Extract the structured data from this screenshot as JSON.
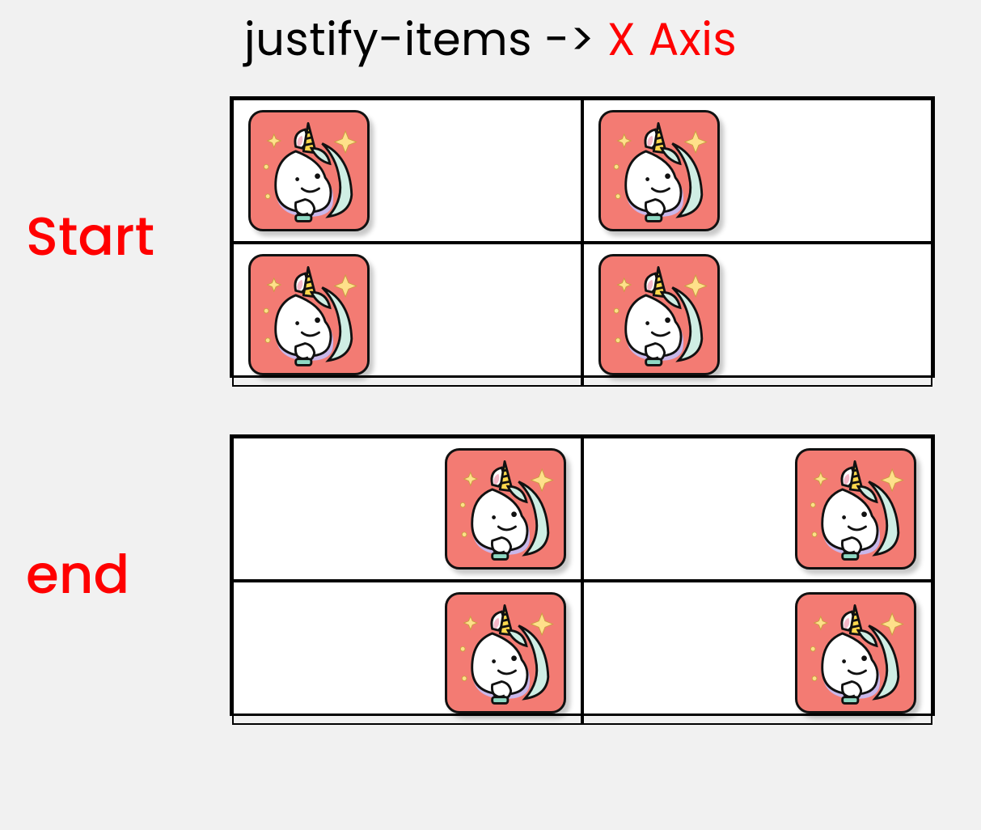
{
  "title": {
    "property": "justify-items ->",
    "axis": "X Axis"
  },
  "examples": [
    {
      "label": "Start",
      "justify": "start"
    },
    {
      "label": "end",
      "justify": "end"
    }
  ],
  "icon_name": "unicorn-icon",
  "colors": {
    "card_bg": "#f37b73",
    "accent": "#ff0000",
    "page_bg": "#f1f1f1"
  }
}
